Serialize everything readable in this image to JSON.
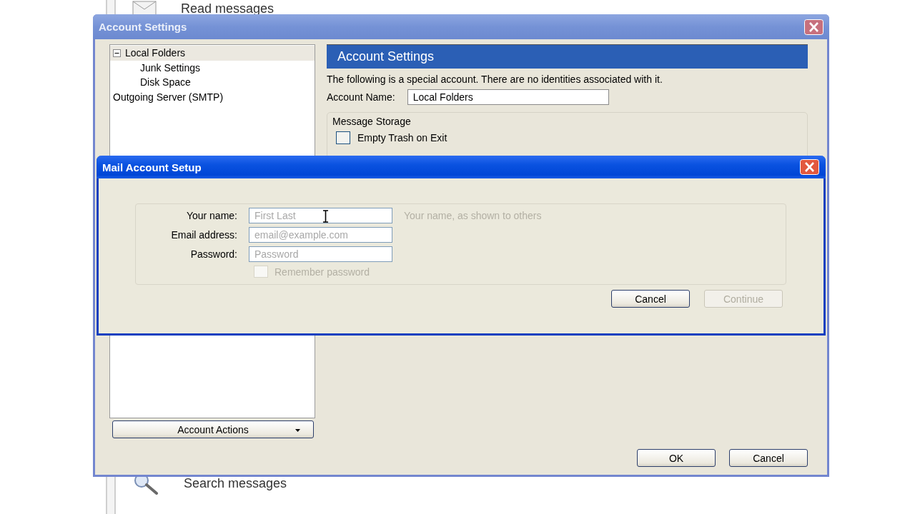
{
  "background": {
    "items": [
      {
        "kind": "mail",
        "label": "Read messages"
      },
      {
        "kind": "search",
        "label": "Search messages"
      }
    ]
  },
  "account_settings": {
    "title": "Account Settings",
    "tree": [
      {
        "label": "Local Folders",
        "expanded": true,
        "selected": true,
        "children": [
          {
            "label": "Junk Settings",
            "selected": false
          },
          {
            "label": "Disk Space",
            "selected": false
          }
        ]
      },
      {
        "label": "Outgoing Server (SMTP)",
        "selected": false
      }
    ],
    "account_actions": "Account Actions",
    "panel_title": "Account Settings",
    "description": "The following is a special account. There are no identities associated with it.",
    "account_name": {
      "label": "Account Name:",
      "value": "Local Folders"
    },
    "message_storage": {
      "legend": "Message Storage",
      "empty_trash": {
        "label": "Empty Trash on Exit",
        "checked": false
      }
    },
    "buttons": [
      "OK",
      "Cancel"
    ]
  },
  "mail_setup": {
    "title": "Mail Account Setup",
    "fields": [
      {
        "label": "Your name:",
        "placeholder": "First Last",
        "hint": "Your name, as shown to others"
      },
      {
        "label": "Email address:",
        "placeholder": "email@example.com"
      },
      {
        "label": "Password:",
        "placeholder": "Password"
      }
    ],
    "remember_password": {
      "label": "Remember password",
      "checked": false,
      "disabled": true
    },
    "buttons": [
      {
        "label": "Cancel",
        "disabled": false
      },
      {
        "label": "Continue",
        "disabled": true
      }
    ]
  }
}
